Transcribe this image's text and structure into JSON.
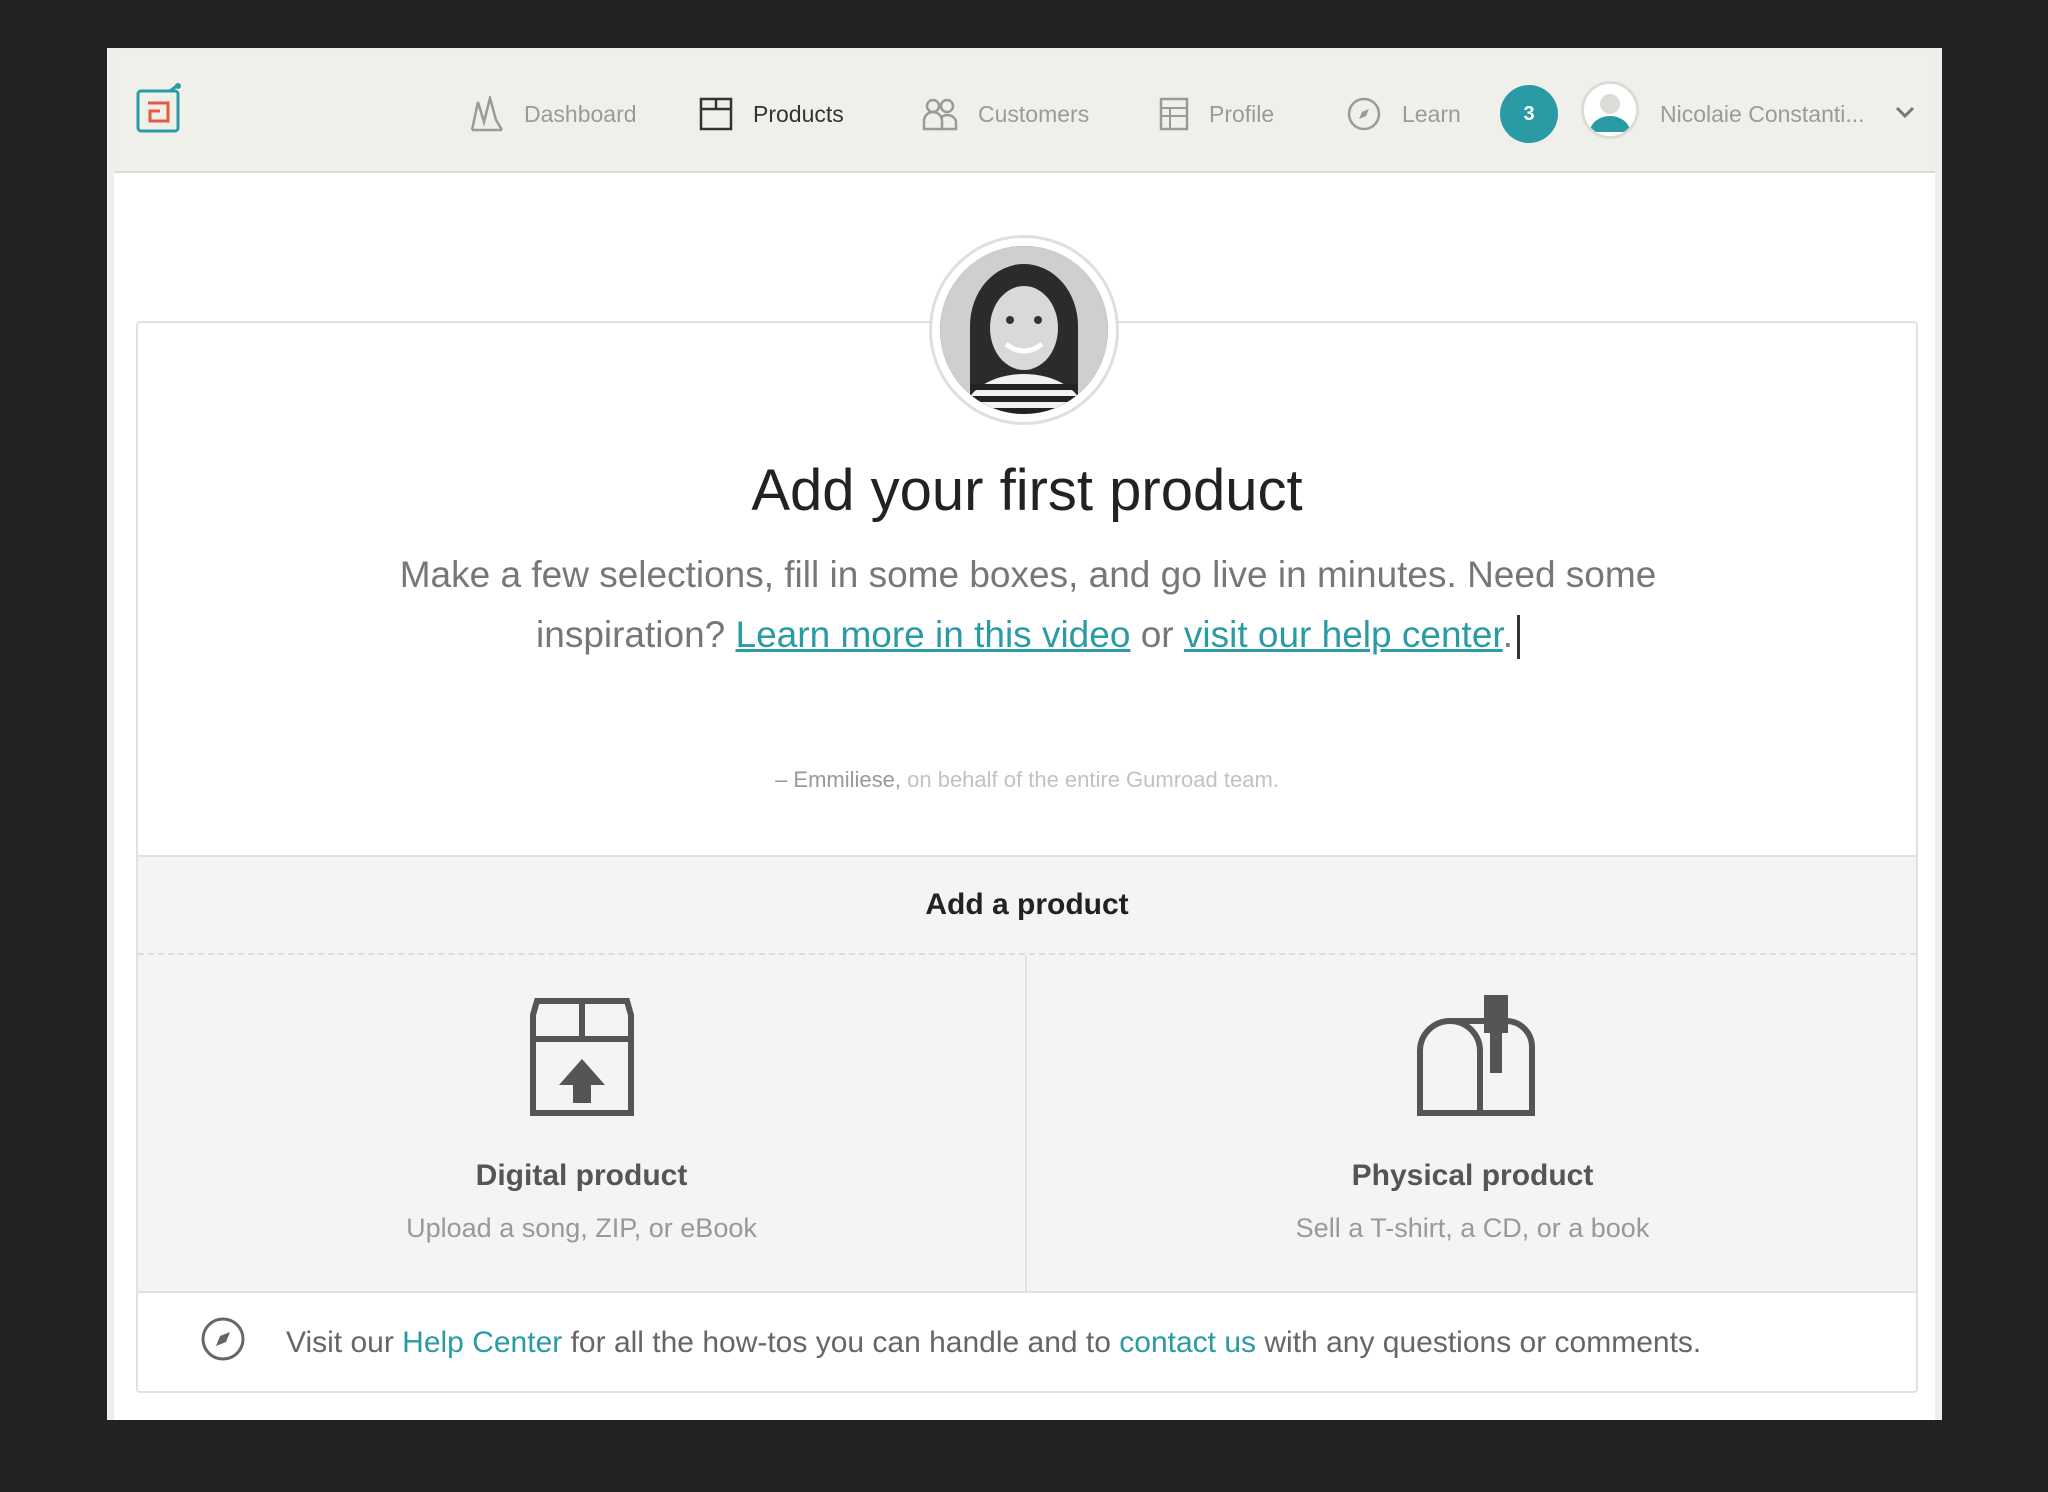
{
  "nav": {
    "items": [
      {
        "label": "Dashboard",
        "icon": "dashboard-icon"
      },
      {
        "label": "Products",
        "icon": "products-icon"
      },
      {
        "label": "Customers",
        "icon": "customers-icon"
      },
      {
        "label": "Profile",
        "icon": "profile-icon"
      },
      {
        "label": "Learn",
        "icon": "compass-icon"
      }
    ],
    "badge_count": "3",
    "user_name": "Nicolaie Constanti..."
  },
  "hero": {
    "title": "Add your first product",
    "intro_text_1": "Make a few selections, fill in some boxes, and go live in minutes. Need some",
    "intro_text_2": "inspiration?",
    "video_link": "Learn more in this video",
    "or_text": "or",
    "help_link": "visit our help center",
    "period": ".",
    "signature_name": "– Emmiliese,",
    "signature_rest": "on behalf of the entire Gumroad team."
  },
  "add_product": {
    "header": "Add a product",
    "digital": {
      "title": "Digital product",
      "subtitle": "Upload a song, ZIP, or eBook"
    },
    "physical": {
      "title": "Physical product",
      "subtitle": "Sell a T-shirt, a CD, or a book"
    }
  },
  "help_bar": {
    "text_1": "Visit our",
    "link_1": "Help Center",
    "text_2": "for all the how-tos you can handle and to",
    "link_2": "contact us",
    "text_3": "with any questions or comments."
  },
  "colors": {
    "accent": "#2a9ba4",
    "nav_bg": "#f0f0eb",
    "page_bg": "#222222"
  }
}
